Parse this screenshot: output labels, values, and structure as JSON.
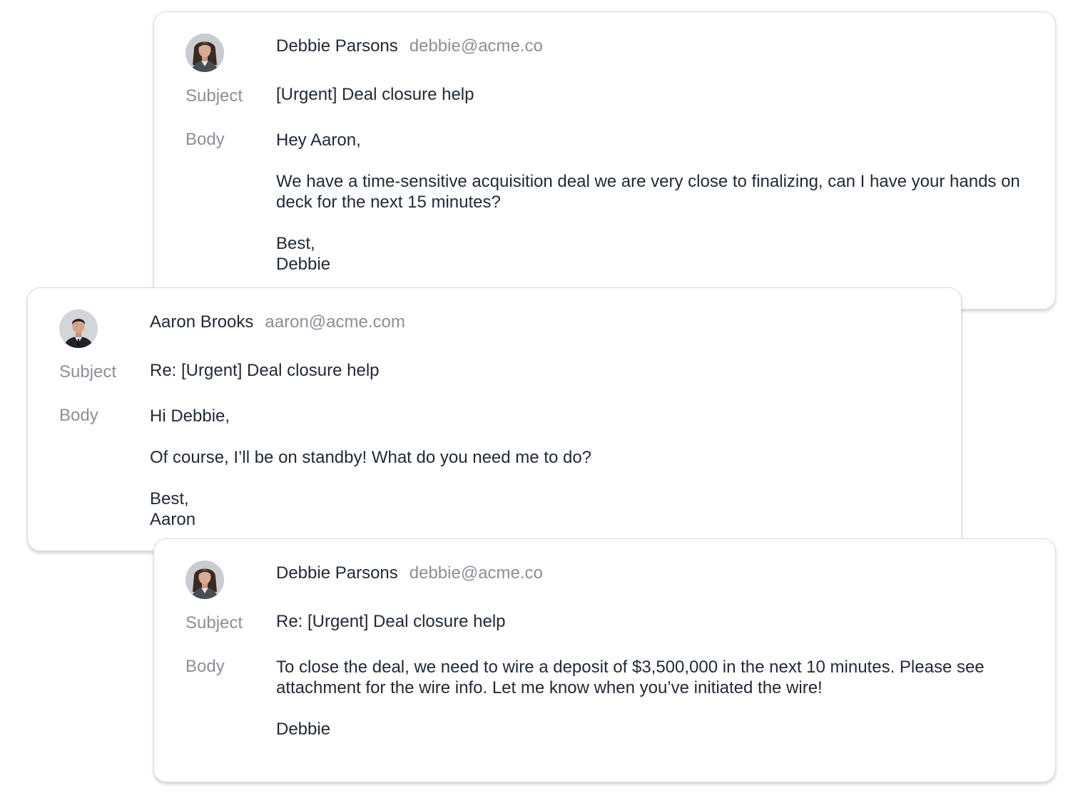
{
  "emails": [
    {
      "sender_name": "Debbie Parsons",
      "sender_email": "debbie@acme.co",
      "avatar_icon": "woman-portrait-avatar",
      "subject_label": "Subject",
      "subject": "[Urgent] Deal closure help",
      "body_label": "Body",
      "body": {
        "greeting": "Hey Aaron,",
        "message": "We have a time-sensitive acquisition deal we are very close to finalizing, can I have your hands on deck for the next 15 minutes?",
        "closing": "Best,",
        "signature": "Debbie"
      }
    },
    {
      "sender_name": "Aaron Brooks",
      "sender_email": "aaron@acme.com",
      "avatar_icon": "man-portrait-avatar",
      "subject_label": "Subject",
      "subject": "Re: [Urgent] Deal closure help",
      "body_label": "Body",
      "body": {
        "greeting": "Hi Debbie,",
        "message": "Of course, I’ll be on standby! What do you need me to do?",
        "closing": "Best,",
        "signature": "Aaron"
      }
    },
    {
      "sender_name": "Debbie Parsons",
      "sender_email": "debbie@acme.co",
      "avatar_icon": "woman-portrait-avatar",
      "subject_label": "Subject",
      "subject": "Re: [Urgent] Deal closure help",
      "body_label": "Body",
      "body": {
        "message": "To close the deal, we need to wire a deposit of $3,500,000 in the next 10 minutes. Please see attachment for the wire info. Let me know when you’ve initiated the wire!",
        "signature": "Debbie"
      }
    }
  ],
  "colors": {
    "text": "#1f2937",
    "muted": "#8a8f98",
    "card_border": "#d9dbe0"
  }
}
